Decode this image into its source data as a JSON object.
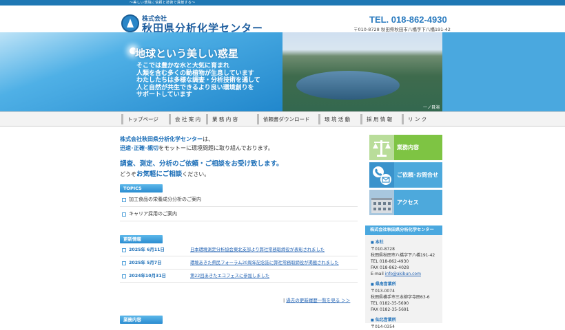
{
  "topbar": {
    "tagline": "〜美しい環境に信頼と技術で貢献する〜"
  },
  "header": {
    "company_small": "株式会社",
    "company_main": "秋田県分析化学センター",
    "tel": "TEL. 018-862-4930",
    "address": "〒010-8728 秋田県秋田市八橋字下八橋191-42"
  },
  "hero": {
    "title": "地球という美しい惑星",
    "copy": "そこでは豊かな水と大気に育まれ\n人類を含む多くの動植物が生息しています\nわたしたちは多様な調査・分析技術を通して\n人と自然が共生できるより良い環境創りを\nサポートしています",
    "photo_caption": "一ノ目潟"
  },
  "nav": [
    "トップページ",
    "会 社 案 内",
    "業 務 内 容",
    "依頼書ダウンロード",
    "環 境 活 動",
    "採 用 情 報",
    "リ ン ク"
  ],
  "intro": {
    "company": "株式会社秋田県分析化学センター",
    "p1_tail": "は、",
    "motto": "迅速･正確･親切",
    "p1_end": "をモットーに環境問題に取り組んでおります。",
    "line2": "調査、測定、分析のご依頼・ご相談をお受け致します。",
    "line3_pre": "どうぞ",
    "line3_em": "お気軽にご相談",
    "line3_post": "ください。"
  },
  "topics": {
    "heading": "TOPICS",
    "items": [
      "加工食品の栄養成分分析のご案内",
      "キャリア採用のご案内"
    ]
  },
  "news": {
    "heading": "更新情報",
    "items": [
      {
        "date": "2025年 6月11日",
        "title": "日本環境測定分析協会東北支部より弊社常務取締役が表彰されました"
      },
      {
        "date": "2025年 5月7日",
        "title": "環境あきた県民フォーラム20周年記念誌に弊社常務取締役が掲載されました"
      },
      {
        "date": "2024年10月31日",
        "title": "第22回あきたエコフェスに参加しました"
      }
    ],
    "more_prefix": "|",
    "more_link": "過去の更新履歴一覧を見る ＞＞"
  },
  "biz_heading": "業務内容",
  "side": {
    "buttons": [
      "業務内容",
      "ご依頼･お問合せ",
      "アクセス"
    ]
  },
  "corp": {
    "heading": "株式会社秋田県分析化学センター",
    "head_office": "本社",
    "head_lines": [
      "〒010-8728",
      "秋田県秋田市八橋字下八橋191-42",
      "TEL 018-862-4930",
      "FAX 018-862-4028"
    ],
    "email_label": "E-mail",
    "email": "info@akibun.com",
    "office2": "県南営業所",
    "office2_lines": [
      "〒013-0074",
      "秋田県横手市三本柳字寺田63-6",
      "TEL 0182-35-5690",
      "FAX 0182-35-5691"
    ],
    "office3": "仙北営業所",
    "office3_lines": [
      "〒014-0354"
    ]
  },
  "colors": {
    "accent": "#1d6fb8",
    "topbar": "#1f78b4",
    "green": "#7ec443",
    "sky": "#4aa8df"
  }
}
